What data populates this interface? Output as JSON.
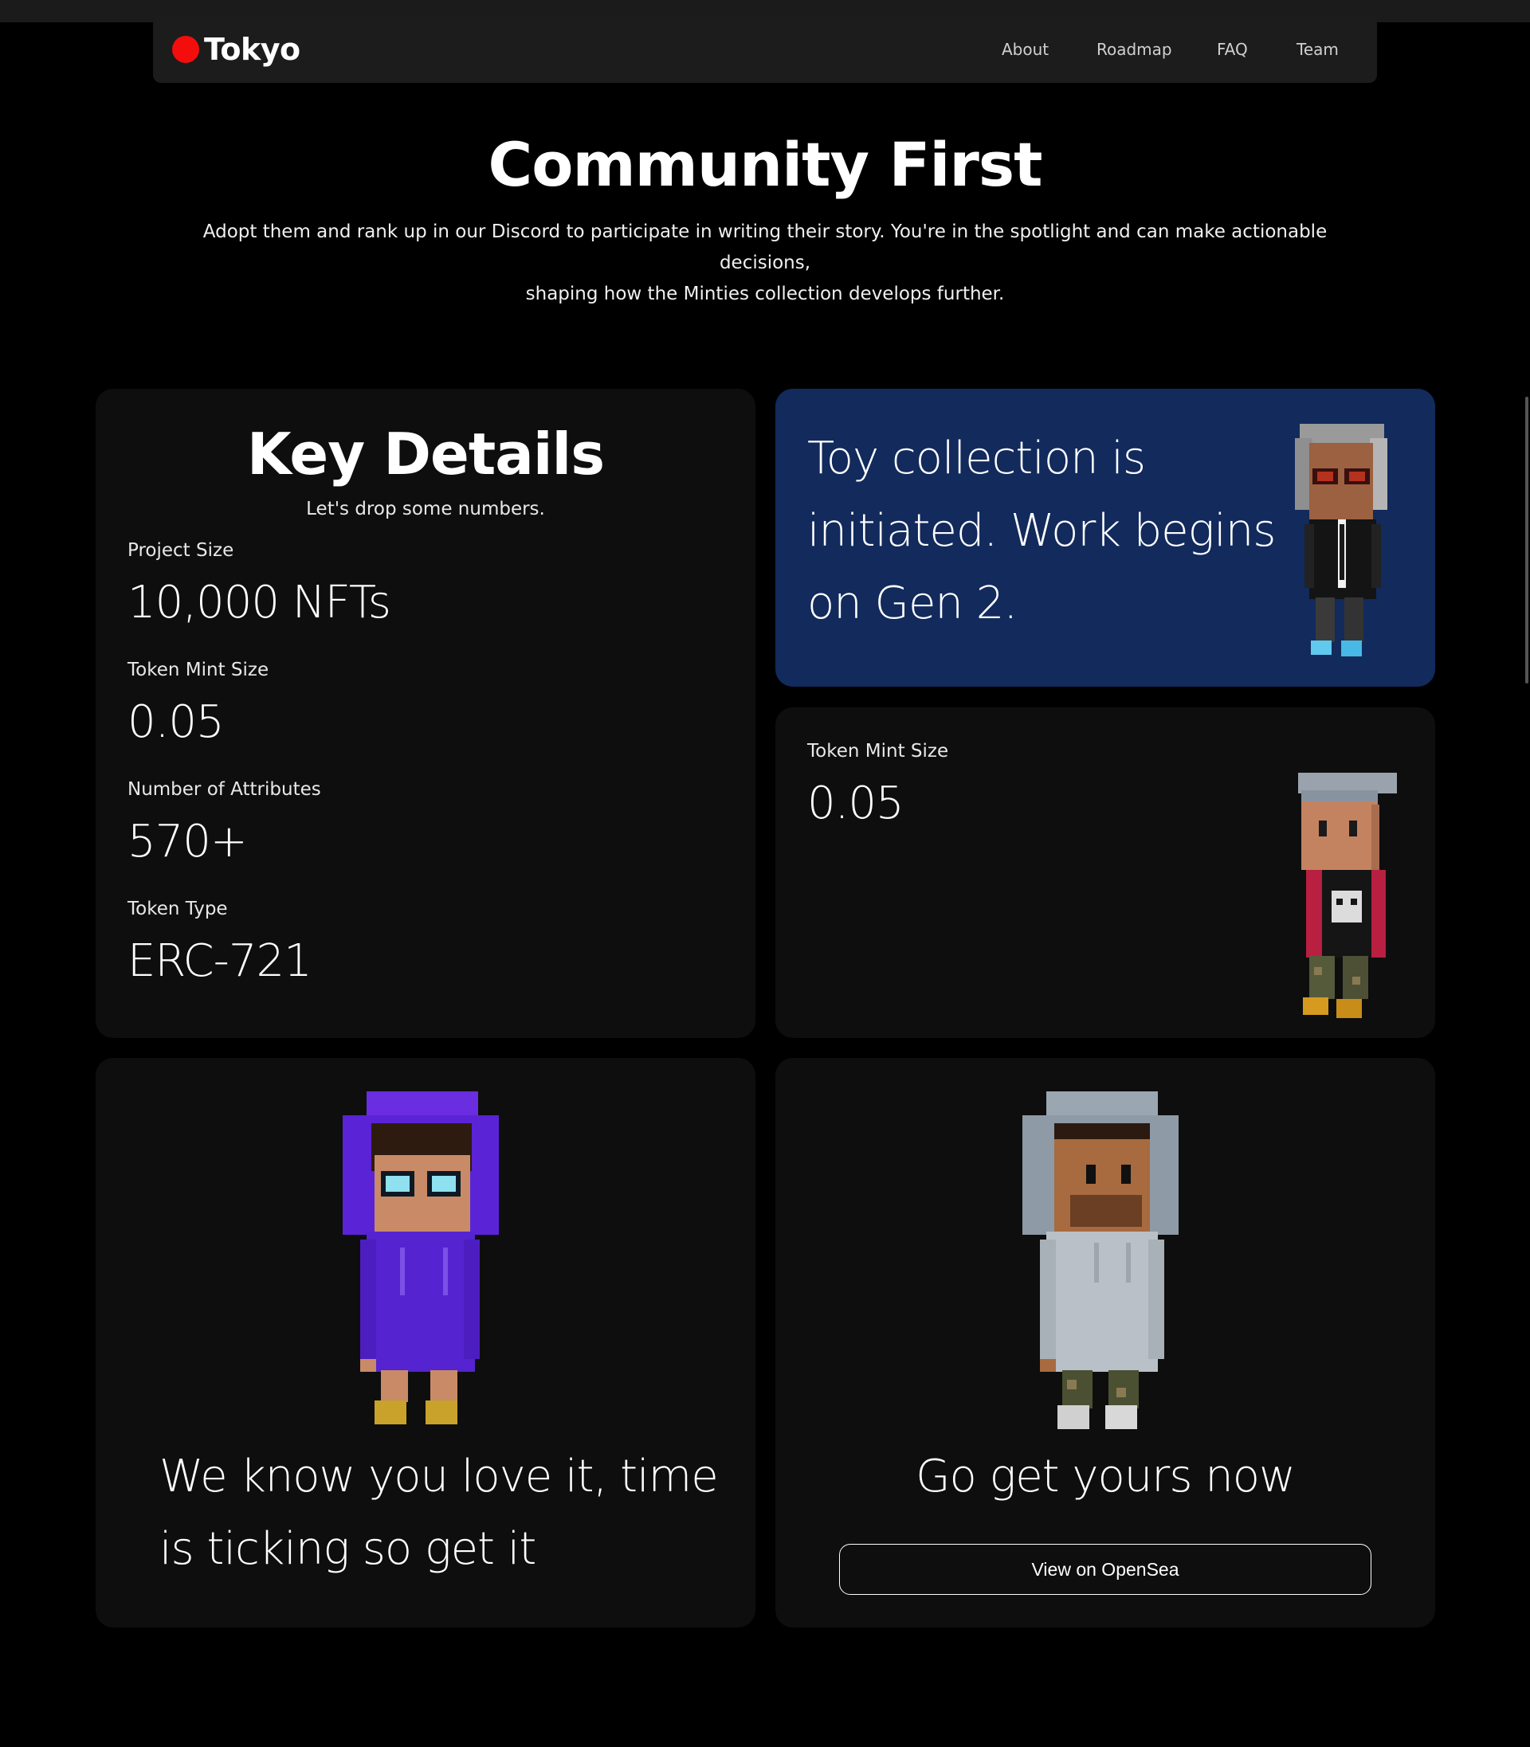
{
  "nav": {
    "brand": "Tokyo",
    "links": [
      "About",
      "Roadmap",
      "FAQ",
      "Team"
    ]
  },
  "hero": {
    "title": "Community First",
    "subtitle_line1": "Adopt them and rank up in our Discord to participate in writing their story. You're in the spotlight and can make actionable decisions,",
    "subtitle_line2": "shaping how the Minties collection develops further."
  },
  "key_details": {
    "title": "Key Details",
    "subtitle": "Let's drop some numbers.",
    "stats": [
      {
        "label": "Project Size",
        "value": "10,000 NFTs"
      },
      {
        "label": "Token Mint Size",
        "value": "0.05"
      },
      {
        "label": "Number of Attributes",
        "value": "570+"
      },
      {
        "label": "Token Type",
        "value": "ERC-721"
      }
    ]
  },
  "announcement": {
    "line1": "Toy collection is",
    "line2": "initiated. Work begins",
    "line3": "on Gen 2."
  },
  "mint_card": {
    "label": "Token Mint Size",
    "value": "0.05"
  },
  "love_card": {
    "line1": "We know you love it, time",
    "line2": "is ticking so get it"
  },
  "cta_card": {
    "heading": "Go get yours now",
    "button": "View on OpenSea"
  },
  "colors": {
    "brand_dot": "#f40d0d",
    "announcement_bg": "#122a5c",
    "card_bg": "#0e0e0e"
  }
}
